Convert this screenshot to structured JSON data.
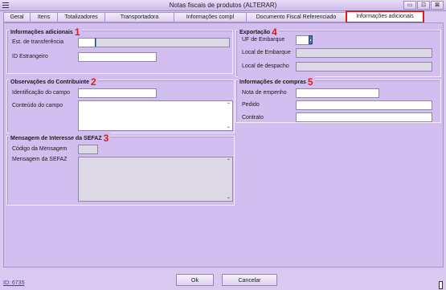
{
  "window": {
    "title": "Notas fiscais de produtos (ALTERAR)",
    "buttons": [
      "▭",
      "⊡",
      "⊠"
    ]
  },
  "tabs": [
    {
      "label": "Geral",
      "active": false
    },
    {
      "label": "Itens",
      "active": false
    },
    {
      "label": "Totalizadores",
      "active": false
    },
    {
      "label": "Transportadora",
      "active": false
    },
    {
      "label": "Informações compl",
      "active": false
    },
    {
      "label": "Documento Fiscal Referenciado",
      "active": false
    },
    {
      "label": "Informações adicionais",
      "active": true
    }
  ],
  "groups": {
    "info_adicionais": {
      "title": "Informações adicionais",
      "marker": "1",
      "est_transferencia_label": "Est. de transferência",
      "id_estrangeiro_label": "ID Estrangeiro",
      "est_transferencia_value": "",
      "est_transferencia_desc": "",
      "id_estrangeiro_value": ""
    },
    "exportacao": {
      "title": "Exportação",
      "marker": "4",
      "uf_embarque_label": "UF de Embarque",
      "local_embarque_label": "Local de Embarque",
      "local_despacho_label": "Local de despacho",
      "uf_embarque_value": "",
      "local_embarque_value": "",
      "local_despacho_value": ""
    },
    "observacoes": {
      "title": "Observações do Contribuinte",
      "marker": "2",
      "identificacao_label": "Identificação do campo",
      "conteudo_label": "Conteúdo do campo",
      "identificacao_value": "",
      "conteudo_value": ""
    },
    "compras": {
      "title": "Informações de compras",
      "marker": "5",
      "nota_empenho_label": "Nota de empenho",
      "pedido_label": "Pedido",
      "contrato_label": "Contrato",
      "nota_empenho_value": "",
      "pedido_value": "",
      "contrato_value": ""
    },
    "sefaz": {
      "title": "Mensagem de Interesse da SEFAZ",
      "marker": "3",
      "codigo_label": "Código da Mensagem",
      "mensagem_label": "Mensagem da SEFAZ",
      "codigo_value": "",
      "mensagem_value": ""
    }
  },
  "footer": {
    "id_link": "ID: 6735",
    "ok_label": "Ok",
    "cancel_label": "Cancelar"
  },
  "colors": {
    "window_bg": "#d9c9f0",
    "panel_bg": "#d2bff0",
    "highlight": "#e01b1b"
  }
}
